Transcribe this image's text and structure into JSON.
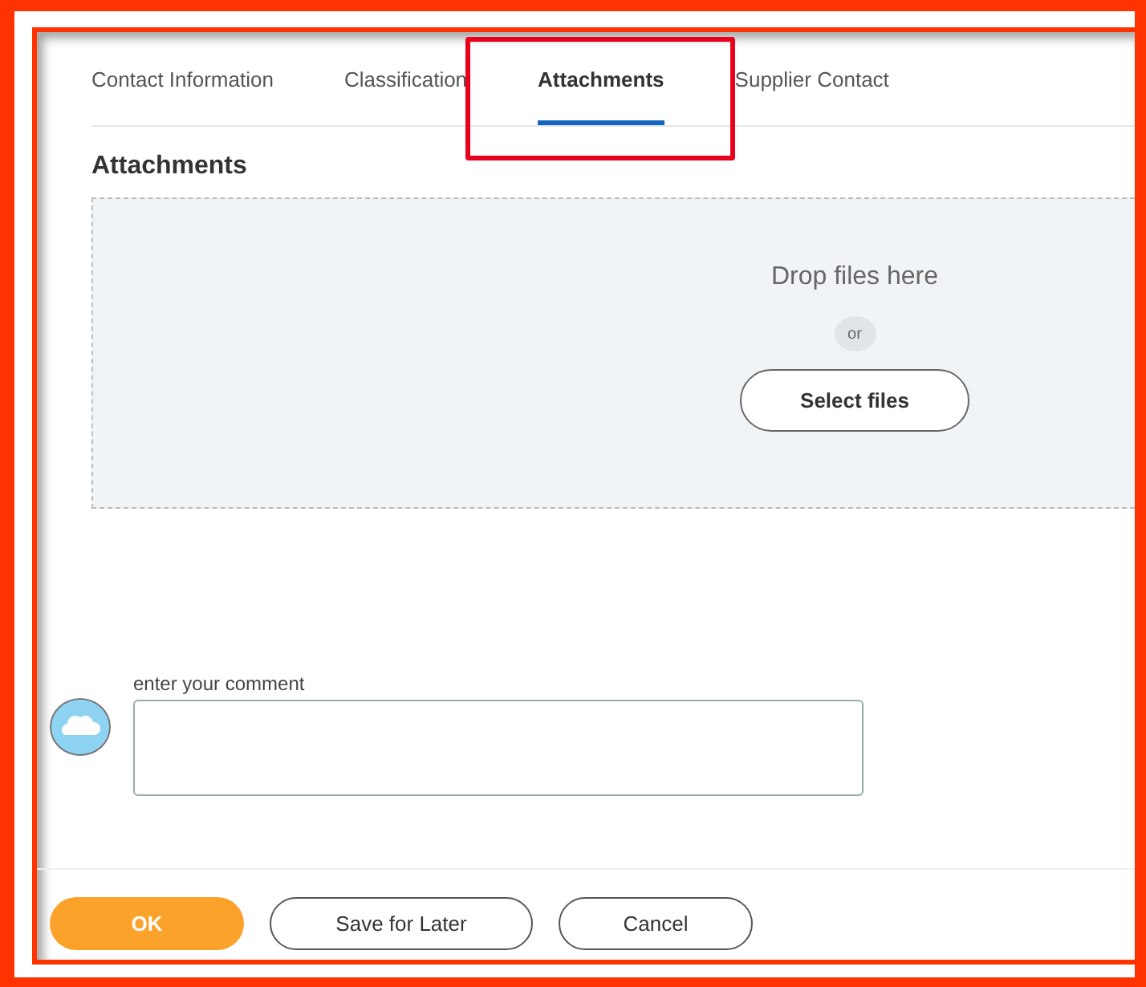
{
  "tabs": [
    {
      "label": "Contact Information",
      "selected": false,
      "highlighted": false
    },
    {
      "label": "Classification",
      "selected": false,
      "highlighted": false
    },
    {
      "label": "Attachments",
      "selected": true,
      "highlighted": true
    },
    {
      "label": "Supplier Contact",
      "selected": false,
      "highlighted": false
    }
  ],
  "section_title": "Attachments",
  "dropzone": {
    "text": "Drop files here",
    "separator": "or",
    "button": "Select files"
  },
  "comment": {
    "label": "enter your comment"
  },
  "buttons": [
    {
      "label": "OK",
      "kind": "primary"
    },
    {
      "label": "Save for Later",
      "kind": "secondary"
    },
    {
      "label": "Cancel",
      "kind": "secondary"
    }
  ]
}
